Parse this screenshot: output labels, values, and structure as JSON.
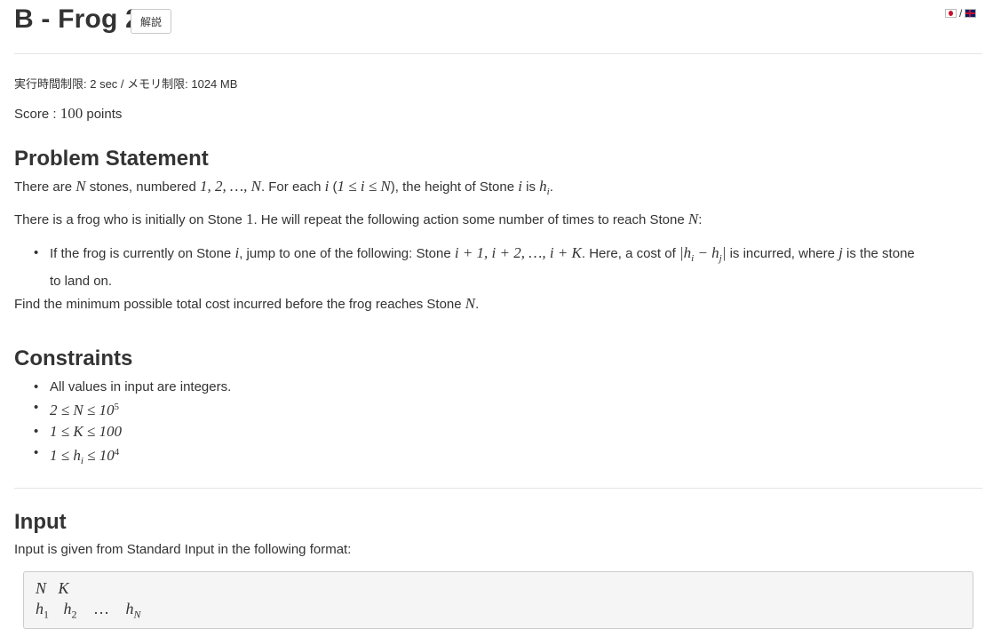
{
  "header": {
    "title": "B - Frog 2",
    "editorial_label": "解説",
    "lang_separator": "/"
  },
  "limits": "実行時間制限: 2 sec / メモリ制限: 1024 MB",
  "score": {
    "label": "Score :",
    "value": "100",
    "unit": "points"
  },
  "statement": {
    "heading": "Problem Statement",
    "p1": {
      "a": "There are ",
      "N1": "N",
      "b": " stones, numbered ",
      "seq": "1, 2, …, N",
      "c": ". For each ",
      "i": "i",
      "d": " (",
      "range": "1 ≤ i ≤ N",
      "e": "), the height of Stone ",
      "i2": "i",
      "f": " is ",
      "hi": "h",
      "hi_sub": "i",
      "g": "."
    },
    "p2": {
      "a": "There is a frog who is initially on Stone ",
      "one": "1",
      "b": ". He will repeat the following action some number of times to reach Stone ",
      "N": "N",
      "c": ":"
    },
    "bullet": {
      "a": "If the frog is currently on Stone ",
      "i": "i",
      "b": ", jump to one of the following: Stone ",
      "seq": "i + 1, i + 2, …, i + K",
      "c": ". Here, a cost of ",
      "cost": "|h",
      "cost_sub1": "i",
      "cost_mid": " − h",
      "cost_sub2": "j",
      "cost_end": "|",
      "d": " is incurred, where ",
      "j": "j",
      "e": " is the stone",
      "wrap": "to land on."
    },
    "p3": {
      "a": "Find the minimum possible total cost incurred before the frog reaches Stone ",
      "N": "N",
      "b": "."
    }
  },
  "constraints": {
    "heading": "Constraints",
    "items": [
      {
        "text": "All values in input are integers."
      },
      {
        "a": "2 ≤ N ≤ 10",
        "sup": "5"
      },
      {
        "a": "1 ≤ K ≤ 100"
      },
      {
        "a": "1 ≤ h",
        "sub": "i",
        "b": " ≤ 10",
        "sup": "4"
      }
    ]
  },
  "input": {
    "heading": "Input",
    "text": "Input is given from Standard Input in the following format:",
    "format_line1": "N   K",
    "format_line2": {
      "h1": "h",
      "s1": "1",
      "h2": "h",
      "s2": "2",
      "dots": "…",
      "hN": "h",
      "sN": "N"
    }
  }
}
